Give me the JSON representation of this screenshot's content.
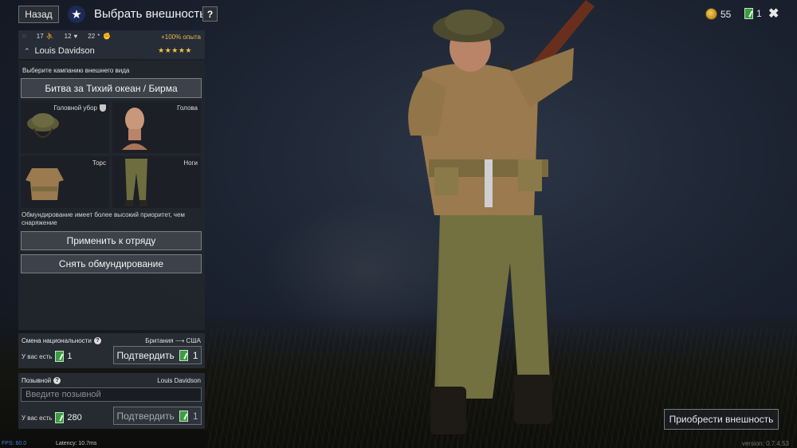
{
  "topbar": {
    "back_label": "Назад",
    "title": "Выбрать внешность",
    "help_label": "?",
    "gold_count": "55",
    "tickets_count": "1"
  },
  "soldier": {
    "stat_1": "17",
    "stat_2": "12",
    "stat_3": "22",
    "xp_bonus": "+100% опыта",
    "name": "Louis Davidson",
    "stars": "★★★★★"
  },
  "appearance": {
    "campaign_section_label": "Выберите кампанию внешнего вида",
    "campaign_button": "Битва за Тихий океан / Бирма",
    "slots": {
      "headgear": "Головной убор",
      "head": "Голова",
      "torso": "Торс",
      "legs": "Ноги"
    },
    "note": "Обмундирование имеет более высокий приоритет, чем снаряжение",
    "apply_button": "Применить к отряду",
    "remove_button": "Снять обмундирование"
  },
  "nationality": {
    "title": "Смена национальности",
    "from_to": "Британия ⟶ США",
    "have_label": "У вас есть",
    "have_value": "1",
    "confirm_label": "Подтвердить",
    "confirm_cost": "1"
  },
  "callsign": {
    "title": "Позывной",
    "current": "Louis Davidson",
    "placeholder": "Введите позывной",
    "have_label": "У вас есть",
    "have_value": "280",
    "confirm_label": "Подтвердить",
    "confirm_cost": "1"
  },
  "buy_button": "Приобрести внешность",
  "debug": {
    "fps": "FPS: 60.0",
    "latency": "Latency: 10.7ms",
    "version": "version: 0.7.4.53"
  },
  "colors": {
    "panel": "#22262d",
    "xp_accent": "#e5b84c",
    "star": "#f0c14a",
    "ticket": "#3e9a43"
  }
}
